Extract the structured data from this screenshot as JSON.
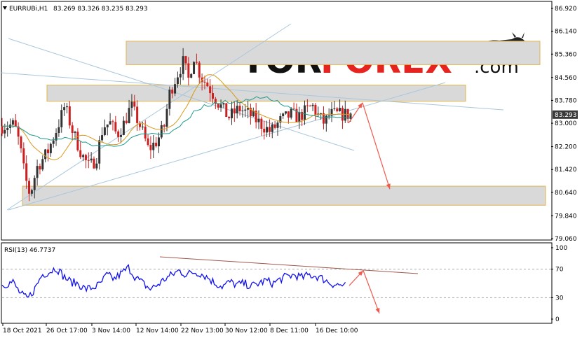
{
  "header": {
    "symbol": "EURRUBi,H1",
    "ohlc": "83.269 83.326 83.235 83.293",
    "triangle_icon": "down-triangle-icon"
  },
  "logo": {
    "part1": "TOR",
    "part2": "FOREX",
    "part3": ".com",
    "icon": "bull-icon"
  },
  "colors": {
    "bull_candle": "#333333",
    "bear_candle": "#cc1f1f",
    "ma_fast": "#d79a1a",
    "ma_slow": "#1f9a8c",
    "rsi_line": "#1010ee",
    "arrow": "#ee5a4e",
    "channel": "#a9c7dc",
    "zone_fill": "#d9d9d9",
    "zone_border": "#e3b44d"
  },
  "chart_data": [
    {
      "type": "candlestick",
      "panel": "price",
      "ylim": [
        79.06,
        86.92
      ],
      "y_ticks": [
        "86.920",
        "86.140",
        "85.360",
        "84.560",
        "83.780",
        "83.000",
        "82.200",
        "81.420",
        "80.640",
        "79.840",
        "79.060"
      ],
      "current_price": "83.293",
      "x_ticks": [
        "18 Oct 2021",
        "26 Oct 17:00",
        "3 Nov 14:00",
        "12 Nov 14:00",
        "22 Nov 13:00",
        "30 Nov 12:00",
        "8 Dec 11:00",
        "16 Dec 10:00"
      ],
      "price_path": [
        [
          0,
          82.9
        ],
        [
          0.035,
          82.95
        ],
        [
          0.05,
          82.3
        ],
        [
          0.065,
          81.2
        ],
        [
          0.08,
          80.55
        ],
        [
          0.1,
          81.5
        ],
        [
          0.13,
          82.0
        ],
        [
          0.16,
          82.9
        ],
        [
          0.18,
          83.6
        ],
        [
          0.2,
          82.8
        ],
        [
          0.23,
          81.9
        ],
        [
          0.25,
          81.5
        ],
        [
          0.27,
          81.8
        ],
        [
          0.29,
          82.9
        ],
        [
          0.31,
          83.0
        ],
        [
          0.33,
          82.6
        ],
        [
          0.35,
          83.0
        ],
        [
          0.37,
          83.6
        ],
        [
          0.4,
          82.8
        ],
        [
          0.42,
          82.1
        ],
        [
          0.445,
          82.4
        ],
        [
          0.465,
          82.9
        ],
        [
          0.48,
          84.0
        ],
        [
          0.5,
          84.6
        ],
        [
          0.52,
          85.1
        ],
        [
          0.535,
          84.5
        ],
        [
          0.55,
          85.3
        ],
        [
          0.57,
          84.6
        ],
        [
          0.59,
          84.3
        ],
        [
          0.62,
          83.7
        ],
        [
          0.65,
          83.2
        ],
        [
          0.68,
          83.5
        ],
        [
          0.71,
          83.3
        ],
        [
          0.74,
          83.0
        ],
        [
          0.77,
          82.7
        ],
        [
          0.8,
          83.1
        ],
        [
          0.83,
          83.3
        ],
        [
          0.85,
          83.2
        ],
        [
          0.87,
          83.4
        ],
        [
          0.89,
          83.6
        ],
        [
          0.91,
          83.2
        ],
        [
          0.925,
          83.0
        ],
        [
          0.94,
          83.3
        ]
      ],
      "zones": [
        {
          "low": 85.0,
          "high": 85.8
        },
        {
          "low": 83.75,
          "high": 84.3
        },
        {
          "low": 80.2,
          "high": 80.85
        }
      ],
      "forecast": [
        [
          83.0,
          83.7
        ],
        [
          83.7,
          80.75
        ]
      ]
    },
    {
      "type": "line",
      "panel": "rsi",
      "title": "RSI(13) 46.7737",
      "ylim": [
        0,
        100
      ],
      "y_ticks": [
        "100",
        "70",
        "30",
        "0"
      ],
      "levels": [
        70,
        30
      ],
      "rsi_path": [
        [
          0,
          48
        ],
        [
          0.03,
          52
        ],
        [
          0.05,
          36
        ],
        [
          0.07,
          28
        ],
        [
          0.09,
          42
        ],
        [
          0.11,
          62
        ],
        [
          0.13,
          66
        ],
        [
          0.15,
          72
        ],
        [
          0.17,
          60
        ],
        [
          0.19,
          52
        ],
        [
          0.21,
          50
        ],
        [
          0.23,
          42
        ],
        [
          0.25,
          44
        ],
        [
          0.27,
          48
        ],
        [
          0.29,
          62
        ],
        [
          0.31,
          56
        ],
        [
          0.33,
          64
        ],
        [
          0.35,
          72
        ],
        [
          0.37,
          58
        ],
        [
          0.39,
          50
        ],
        [
          0.41,
          42
        ],
        [
          0.43,
          48
        ],
        [
          0.45,
          56
        ],
        [
          0.47,
          62
        ],
        [
          0.49,
          68
        ],
        [
          0.51,
          62
        ],
        [
          0.53,
          66
        ],
        [
          0.55,
          64
        ],
        [
          0.57,
          58
        ],
        [
          0.59,
          50
        ],
        [
          0.61,
          46
        ],
        [
          0.63,
          52
        ],
        [
          0.65,
          48
        ],
        [
          0.67,
          50
        ],
        [
          0.69,
          46
        ],
        [
          0.71,
          50
        ],
        [
          0.73,
          54
        ],
        [
          0.75,
          50
        ],
        [
          0.77,
          56
        ],
        [
          0.79,
          60
        ],
        [
          0.81,
          62
        ],
        [
          0.83,
          58
        ],
        [
          0.85,
          62
        ],
        [
          0.87,
          60
        ],
        [
          0.89,
          56
        ],
        [
          0.91,
          50
        ],
        [
          0.93,
          48
        ],
        [
          0.95,
          46.77
        ]
      ],
      "forecast": [
        [
          47,
          68
        ],
        [
          68,
          8
        ]
      ]
    }
  ]
}
